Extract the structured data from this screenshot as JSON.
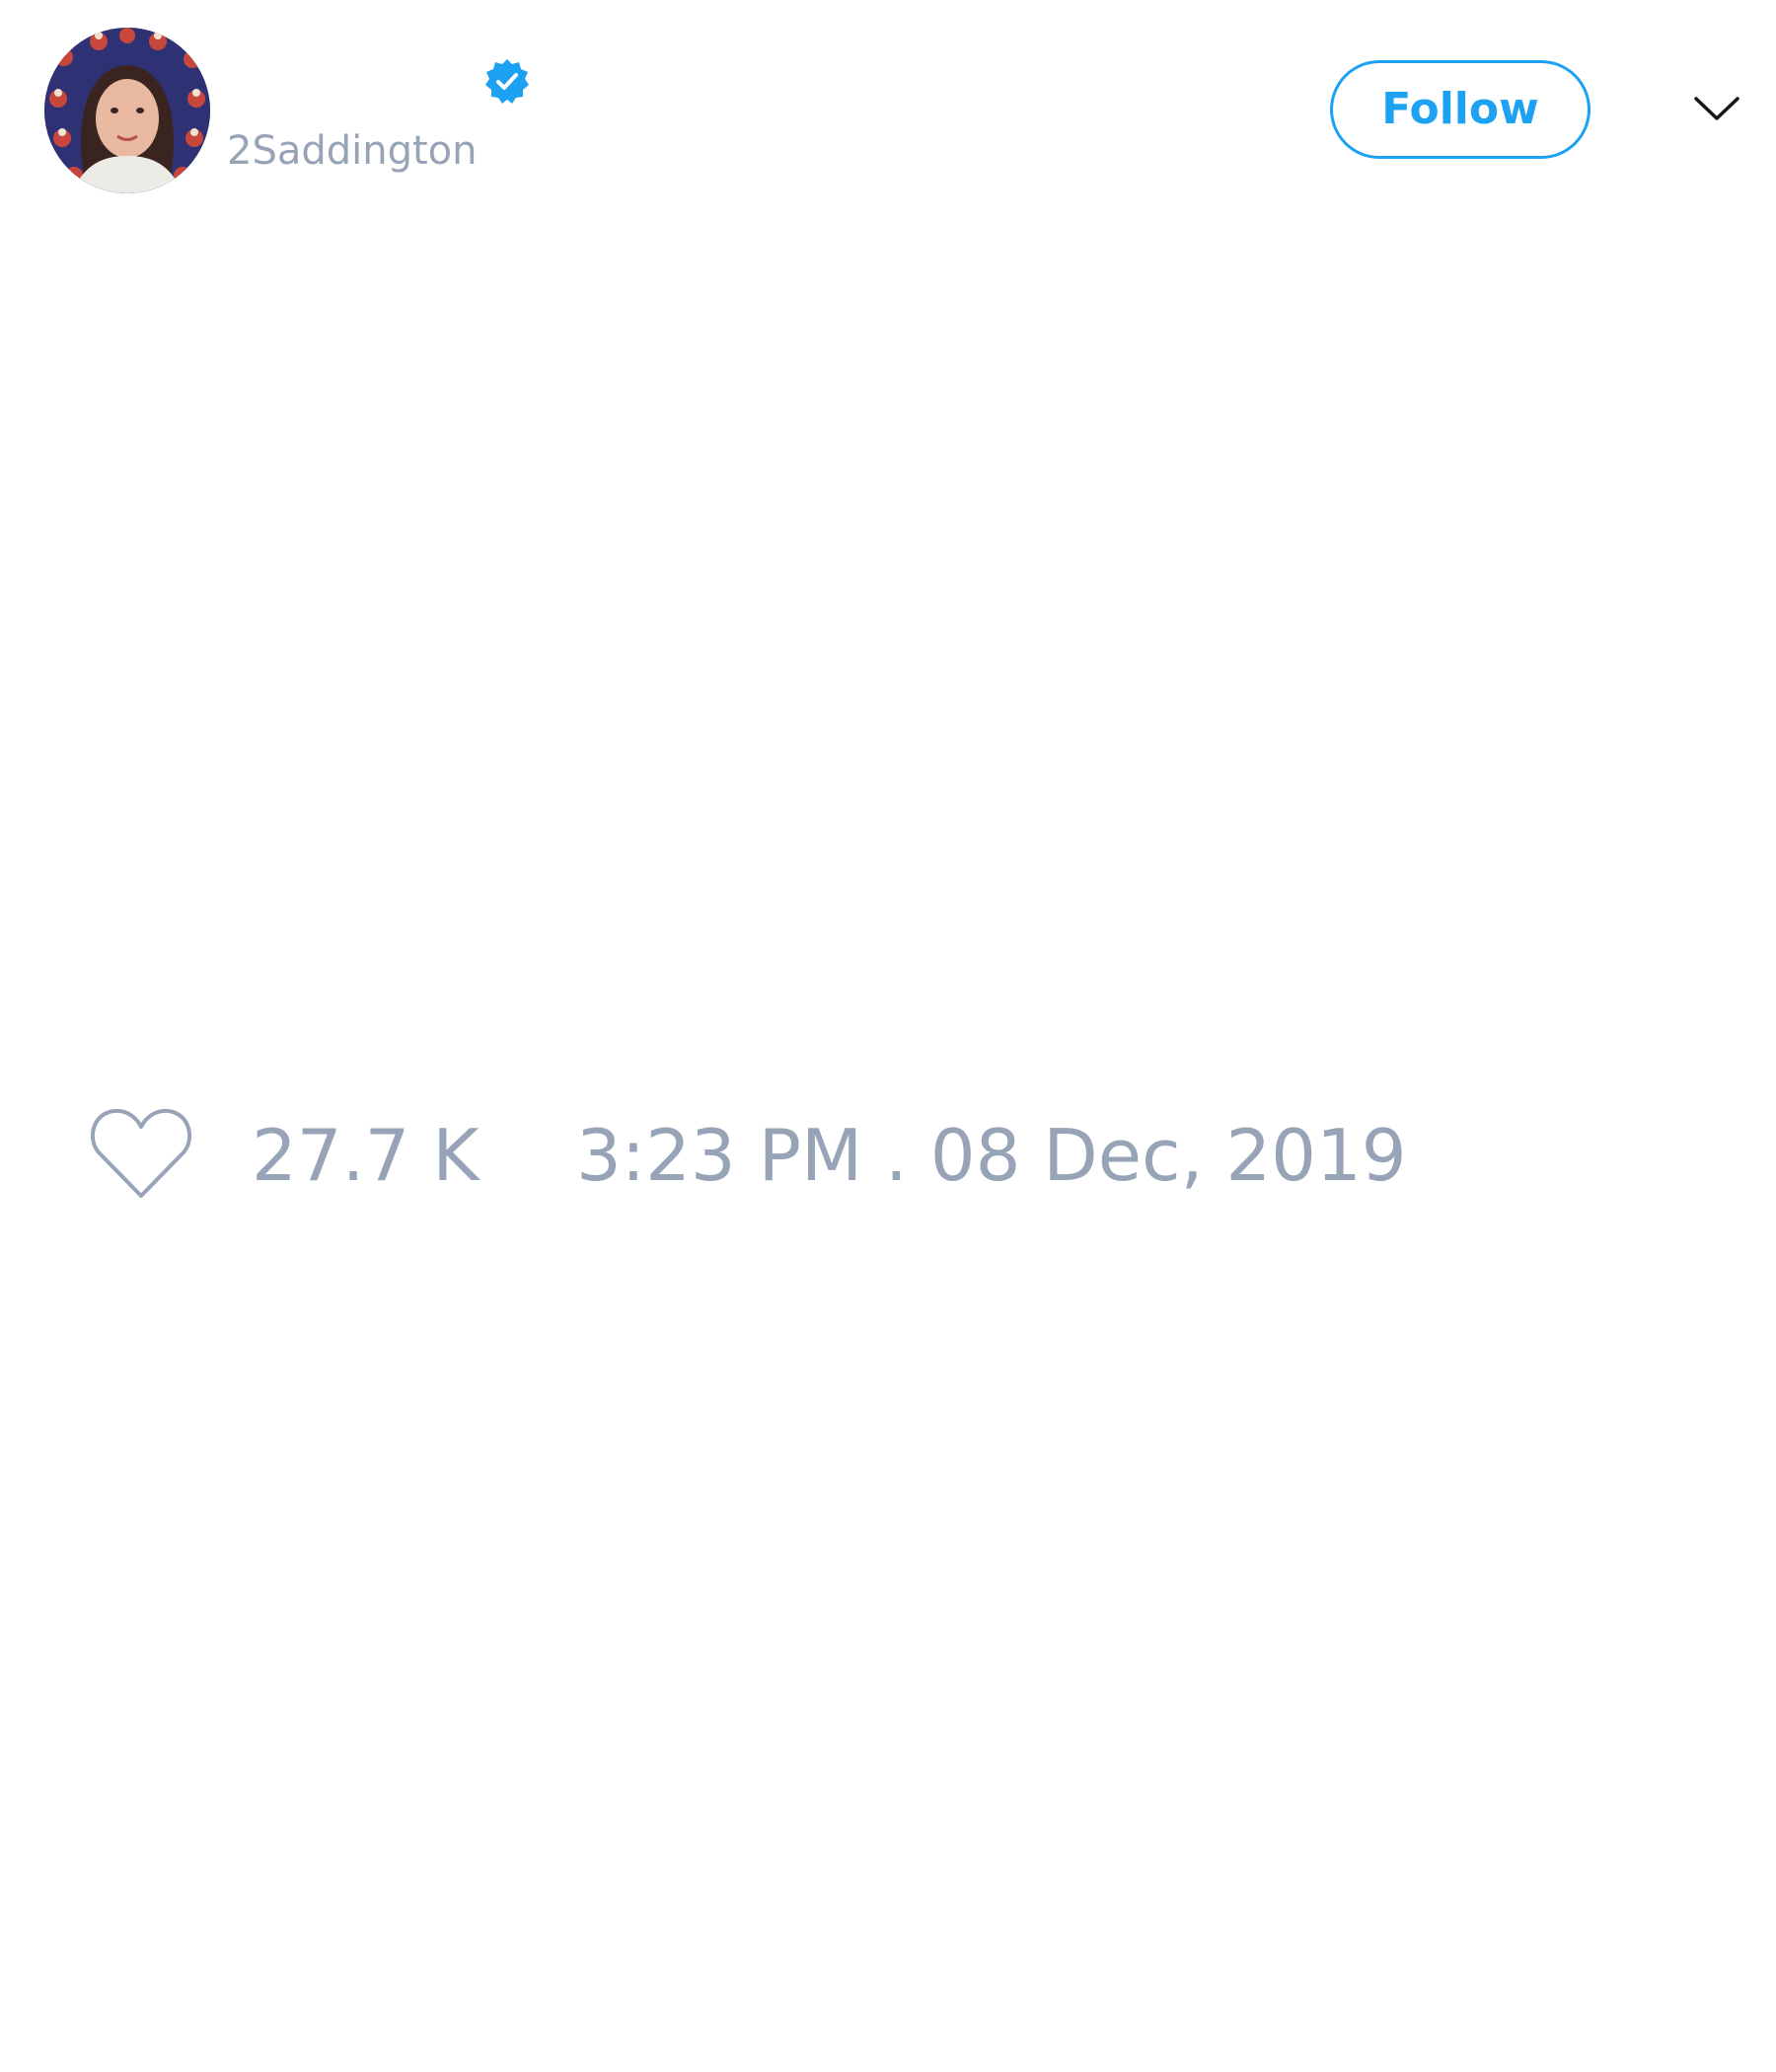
{
  "tweet": {
    "author": {
      "display_name": "",
      "handle": "2Saddington",
      "verified": true,
      "avatar_icon": "profile-photo"
    },
    "follow_label": "Follow",
    "menu_icon": "chevron-down-icon",
    "text": "",
    "like_icon": "heart-outline-icon",
    "like_count": "27.7 K",
    "timestamp": "3:23 PM . 08 Dec, 2019"
  },
  "colors": {
    "accent": "#1da1f2",
    "muted_text": "#97a3b6",
    "background": "#ffffff"
  }
}
